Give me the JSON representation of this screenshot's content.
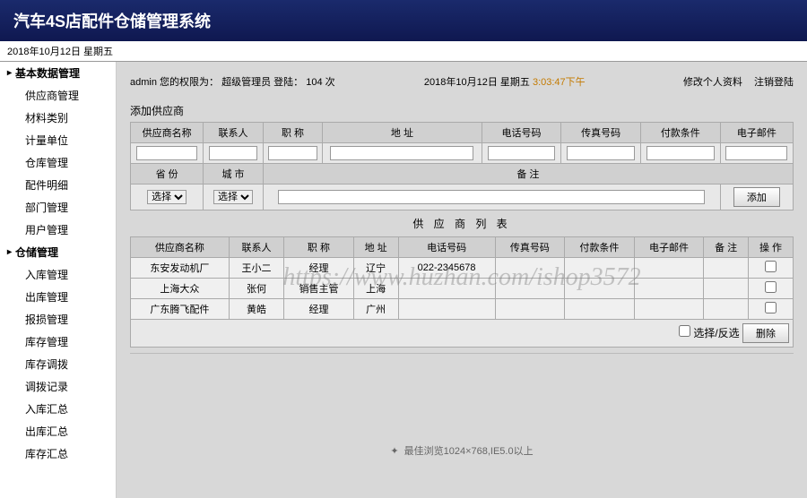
{
  "app_title": "汽车4S店配件仓储管理系统",
  "datebar": "2018年10月12日 星期五",
  "sidebar": {
    "sections": [
      {
        "label": "基本数据管理",
        "items": [
          "供应商管理",
          "材料类别",
          "计量单位",
          "仓库管理",
          "配件明细",
          "部门管理",
          "用户管理"
        ]
      },
      {
        "label": "仓储管理",
        "items": [
          "入库管理",
          "出库管理",
          "报损管理",
          "库存管理",
          "库存调拨",
          "调拨记录",
          "入库汇总",
          "出库汇总",
          "库存汇总"
        ]
      }
    ]
  },
  "topbar": {
    "user": "admin",
    "role_prefix": "您的权限为：",
    "role": "超级管理员",
    "login_prefix": "登陆：",
    "login_count": "104",
    "login_suffix": "次",
    "time_date": "2018年10月12日 星期五",
    "time_clock": "3:03:47下午",
    "link_profile": "修改个人资料",
    "link_logout": "注销登陆"
  },
  "form": {
    "title": "添加供应商",
    "headers": [
      "供应商名称",
      "联系人",
      "职 称",
      "地 址",
      "电话号码",
      "传真号码",
      "付款条件",
      "电子邮件"
    ],
    "row2_headers": [
      "省 份",
      "城 市",
      "备 注"
    ],
    "select_placeholder": "选择",
    "btn_add": "添加"
  },
  "list": {
    "title": "供 应 商 列 表",
    "headers": [
      "供应商名称",
      "联系人",
      "职 称",
      "地 址",
      "电话号码",
      "传真号码",
      "付款条件",
      "电子邮件",
      "备 注",
      "操 作"
    ],
    "rows": [
      {
        "name": "东安发动机厂",
        "contact": "王小二",
        "title": "经理",
        "addr": "辽宁",
        "phone": "022-2345678",
        "fax": "",
        "pay": "",
        "email": "",
        "note": ""
      },
      {
        "name": "上海大众",
        "contact": "张何",
        "title": "销售主管",
        "addr": "上海",
        "phone": "",
        "fax": "",
        "pay": "",
        "email": "",
        "note": ""
      },
      {
        "name": "广东腾飞配件",
        "contact": "黄皓",
        "title": "经理",
        "addr": "广州",
        "phone": "",
        "fax": "",
        "pay": "",
        "email": "",
        "note": ""
      }
    ],
    "select_toggle": "选择/反选",
    "btn_delete": "删除"
  },
  "footer_note": "最佳浏览1024×768,IE5.0以上",
  "watermark": "https://www.huzhan.com/ishop3572"
}
